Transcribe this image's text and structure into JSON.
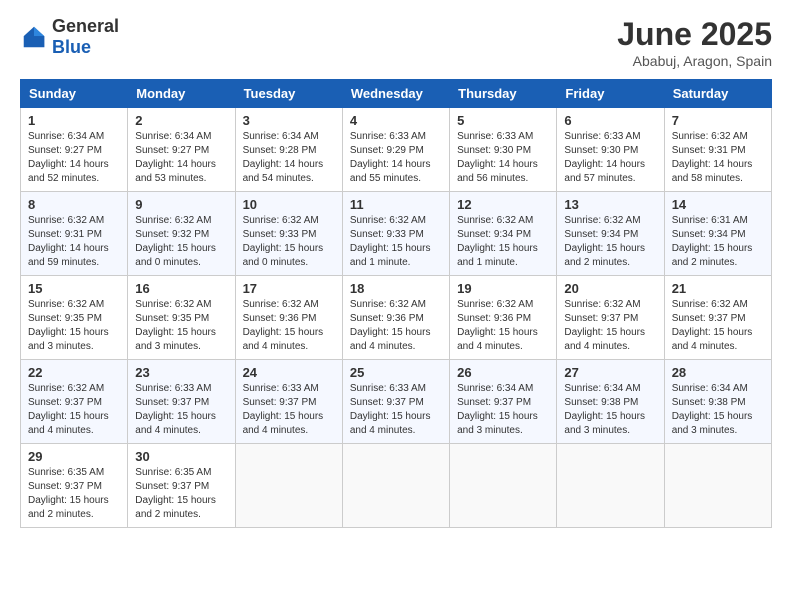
{
  "header": {
    "logo_general": "General",
    "logo_blue": "Blue",
    "title": "June 2025",
    "subtitle": "Ababuj, Aragon, Spain"
  },
  "calendar": {
    "days_of_week": [
      "Sunday",
      "Monday",
      "Tuesday",
      "Wednesday",
      "Thursday",
      "Friday",
      "Saturday"
    ],
    "weeks": [
      [
        null,
        {
          "day": "2",
          "sunrise": "Sunrise: 6:34 AM",
          "sunset": "Sunset: 9:27 PM",
          "daylight": "Daylight: 14 hours and 53 minutes."
        },
        {
          "day": "3",
          "sunrise": "Sunrise: 6:34 AM",
          "sunset": "Sunset: 9:28 PM",
          "daylight": "Daylight: 14 hours and 54 minutes."
        },
        {
          "day": "4",
          "sunrise": "Sunrise: 6:33 AM",
          "sunset": "Sunset: 9:29 PM",
          "daylight": "Daylight: 14 hours and 55 minutes."
        },
        {
          "day": "5",
          "sunrise": "Sunrise: 6:33 AM",
          "sunset": "Sunset: 9:30 PM",
          "daylight": "Daylight: 14 hours and 56 minutes."
        },
        {
          "day": "6",
          "sunrise": "Sunrise: 6:33 AM",
          "sunset": "Sunset: 9:30 PM",
          "daylight": "Daylight: 14 hours and 57 minutes."
        },
        {
          "day": "7",
          "sunrise": "Sunrise: 6:32 AM",
          "sunset": "Sunset: 9:31 PM",
          "daylight": "Daylight: 14 hours and 58 minutes."
        }
      ],
      [
        {
          "day": "1",
          "sunrise": "Sunrise: 6:34 AM",
          "sunset": "Sunset: 9:27 PM",
          "daylight": "Daylight: 14 hours and 52 minutes."
        },
        {
          "day": "8",
          "sunrise": "Sunrise: 6:32 AM",
          "sunset": "Sunset: 9:31 PM",
          "daylight": "Daylight: 14 hours and 59 minutes."
        },
        {
          "day": "9",
          "sunrise": "Sunrise: 6:32 AM",
          "sunset": "Sunset: 9:32 PM",
          "daylight": "Daylight: 15 hours and 0 minutes."
        },
        {
          "day": "10",
          "sunrise": "Sunrise: 6:32 AM",
          "sunset": "Sunset: 9:33 PM",
          "daylight": "Daylight: 15 hours and 0 minutes."
        },
        {
          "day": "11",
          "sunrise": "Sunrise: 6:32 AM",
          "sunset": "Sunset: 9:33 PM",
          "daylight": "Daylight: 15 hours and 1 minute."
        },
        {
          "day": "12",
          "sunrise": "Sunrise: 6:32 AM",
          "sunset": "Sunset: 9:34 PM",
          "daylight": "Daylight: 15 hours and 1 minute."
        },
        {
          "day": "13",
          "sunrise": "Sunrise: 6:32 AM",
          "sunset": "Sunset: 9:34 PM",
          "daylight": "Daylight: 15 hours and 2 minutes."
        },
        {
          "day": "14",
          "sunrise": "Sunrise: 6:31 AM",
          "sunset": "Sunset: 9:34 PM",
          "daylight": "Daylight: 15 hours and 2 minutes."
        }
      ],
      [
        {
          "day": "15",
          "sunrise": "Sunrise: 6:32 AM",
          "sunset": "Sunset: 9:35 PM",
          "daylight": "Daylight: 15 hours and 3 minutes."
        },
        {
          "day": "16",
          "sunrise": "Sunrise: 6:32 AM",
          "sunset": "Sunset: 9:35 PM",
          "daylight": "Daylight: 15 hours and 3 minutes."
        },
        {
          "day": "17",
          "sunrise": "Sunrise: 6:32 AM",
          "sunset": "Sunset: 9:36 PM",
          "daylight": "Daylight: 15 hours and 4 minutes."
        },
        {
          "day": "18",
          "sunrise": "Sunrise: 6:32 AM",
          "sunset": "Sunset: 9:36 PM",
          "daylight": "Daylight: 15 hours and 4 minutes."
        },
        {
          "day": "19",
          "sunrise": "Sunrise: 6:32 AM",
          "sunset": "Sunset: 9:36 PM",
          "daylight": "Daylight: 15 hours and 4 minutes."
        },
        {
          "day": "20",
          "sunrise": "Sunrise: 6:32 AM",
          "sunset": "Sunset: 9:37 PM",
          "daylight": "Daylight: 15 hours and 4 minutes."
        },
        {
          "day": "21",
          "sunrise": "Sunrise: 6:32 AM",
          "sunset": "Sunset: 9:37 PM",
          "daylight": "Daylight: 15 hours and 4 minutes."
        }
      ],
      [
        {
          "day": "22",
          "sunrise": "Sunrise: 6:32 AM",
          "sunset": "Sunset: 9:37 PM",
          "daylight": "Daylight: 15 hours and 4 minutes."
        },
        {
          "day": "23",
          "sunrise": "Sunrise: 6:33 AM",
          "sunset": "Sunset: 9:37 PM",
          "daylight": "Daylight: 15 hours and 4 minutes."
        },
        {
          "day": "24",
          "sunrise": "Sunrise: 6:33 AM",
          "sunset": "Sunset: 9:37 PM",
          "daylight": "Daylight: 15 hours and 4 minutes."
        },
        {
          "day": "25",
          "sunrise": "Sunrise: 6:33 AM",
          "sunset": "Sunset: 9:37 PM",
          "daylight": "Daylight: 15 hours and 4 minutes."
        },
        {
          "day": "26",
          "sunrise": "Sunrise: 6:34 AM",
          "sunset": "Sunset: 9:37 PM",
          "daylight": "Daylight: 15 hours and 3 minutes."
        },
        {
          "day": "27",
          "sunrise": "Sunrise: 6:34 AM",
          "sunset": "Sunset: 9:38 PM",
          "daylight": "Daylight: 15 hours and 3 minutes."
        },
        {
          "day": "28",
          "sunrise": "Sunrise: 6:34 AM",
          "sunset": "Sunset: 9:38 PM",
          "daylight": "Daylight: 15 hours and 3 minutes."
        }
      ],
      [
        {
          "day": "29",
          "sunrise": "Sunrise: 6:35 AM",
          "sunset": "Sunset: 9:37 PM",
          "daylight": "Daylight: 15 hours and 2 minutes."
        },
        {
          "day": "30",
          "sunrise": "Sunrise: 6:35 AM",
          "sunset": "Sunset: 9:37 PM",
          "daylight": "Daylight: 15 hours and 2 minutes."
        },
        null,
        null,
        null,
        null,
        null
      ]
    ]
  }
}
